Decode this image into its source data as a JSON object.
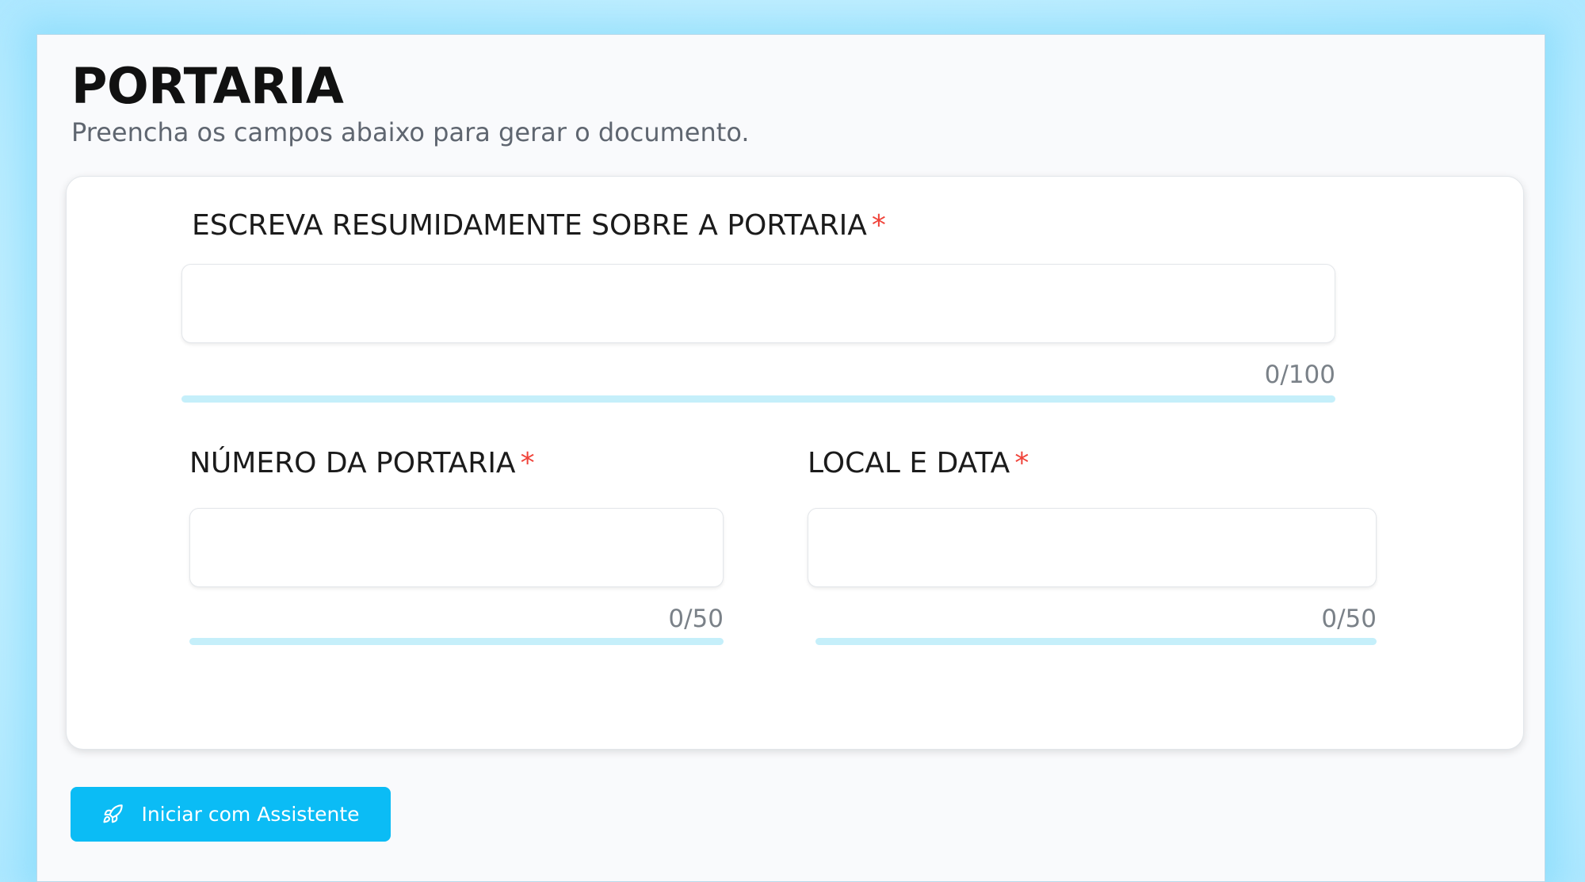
{
  "header": {
    "title": "PORTARIA",
    "subtitle": "Preencha os campos abaixo para gerar o documento."
  },
  "form": {
    "resumo": {
      "label": "ESCREVA RESUMIDAMENTE SOBRE A PORTARIA",
      "required_mark": "*",
      "value": "",
      "counter": "0/100",
      "progress": 0
    },
    "numero": {
      "label": "NÚMERO DA PORTARIA",
      "required_mark": "*",
      "value": "",
      "counter": "0/50",
      "progress": 0
    },
    "local_data": {
      "label": "LOCAL E DATA",
      "required_mark": "*",
      "value": "",
      "counter": "0/50",
      "progress": 0
    }
  },
  "actions": {
    "start_label": "Iniciar com Assistente",
    "start_icon": "rocket-icon"
  },
  "colors": {
    "accent": "#0bbcf5",
    "required": "#f0433a",
    "progress_track": "#c5effa"
  }
}
